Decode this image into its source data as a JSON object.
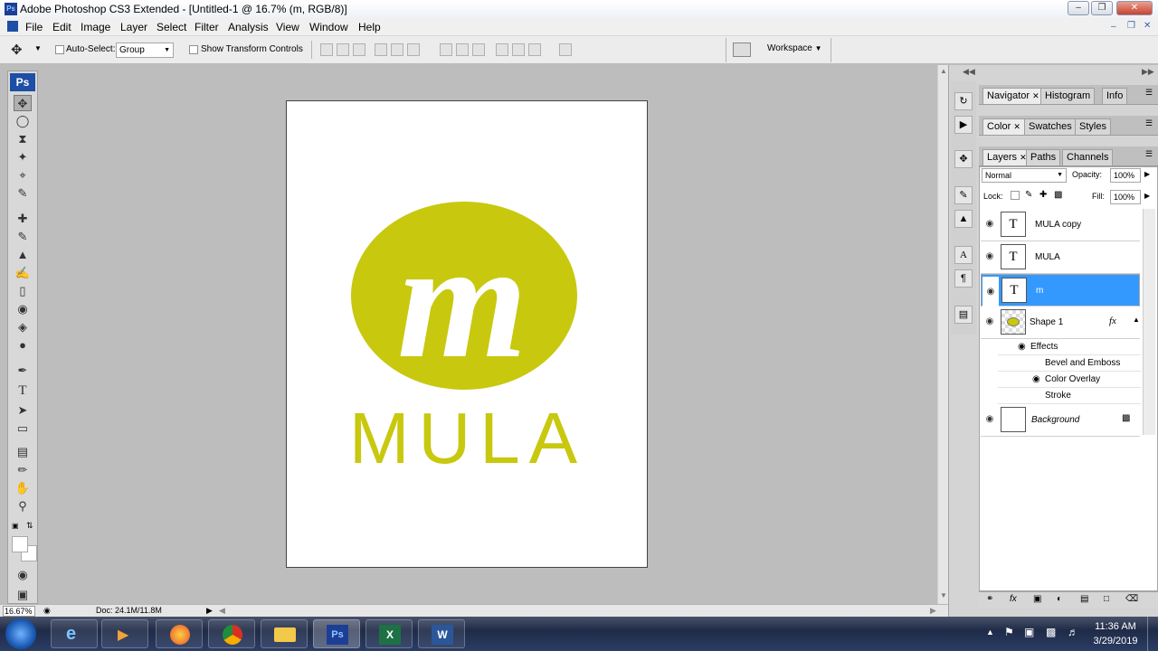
{
  "window": {
    "title": "Adobe Photoshop CS3 Extended - [Untitled-1 @ 16.7% (m, RGB/8)]"
  },
  "menu": [
    "File",
    "Edit",
    "Image",
    "Layer",
    "Select",
    "Filter",
    "Analysis",
    "View",
    "Window",
    "Help"
  ],
  "options": {
    "auto_select_label": "Auto-Select:",
    "auto_select_value": "Group",
    "show_transform_label": "Show Transform Controls",
    "workspace_label": "Workspace"
  },
  "toolbox": {
    "logo": "Ps"
  },
  "canvas": {
    "logo_letter": "m",
    "logo_text": "MULA",
    "logo_color": "#c8c80f"
  },
  "status": {
    "zoom": "16.67%",
    "doc": "Doc: 24.1M/11.8M"
  },
  "panels": {
    "group1_tabs": [
      "Navigator",
      "Histogram",
      "Info"
    ],
    "group2_tabs": [
      "Color",
      "Swatches",
      "Styles"
    ],
    "group3_tabs": [
      "Layers",
      "Paths",
      "Channels"
    ]
  },
  "layers_panel": {
    "blend_mode": "Normal",
    "opacity_label": "Opacity:",
    "opacity_value": "100%",
    "lock_label": "Lock:",
    "fill_label": "Fill:",
    "fill_value": "100%",
    "layers": [
      {
        "name": "MULA copy",
        "thumb": "T"
      },
      {
        "name": "MULA",
        "thumb": "T"
      },
      {
        "name": "m",
        "thumb": "T"
      },
      {
        "name": "Shape 1",
        "fx": "fx"
      }
    ],
    "effects_label": "Effects",
    "effects": [
      "Bevel and Emboss",
      "Color Overlay",
      "Stroke"
    ],
    "background": "Background"
  },
  "taskbar": {
    "time": "11:36 AM",
    "date": "3/29/2019"
  }
}
